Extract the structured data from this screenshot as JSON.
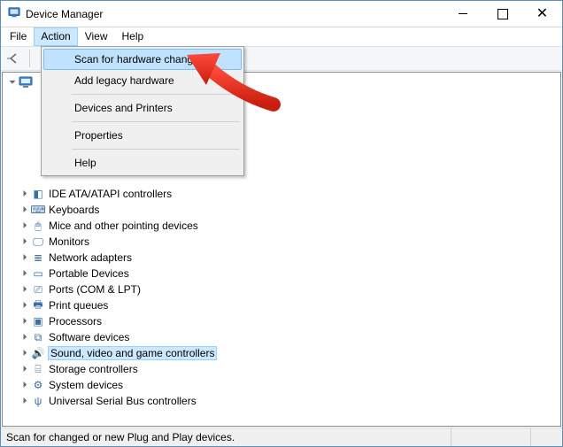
{
  "window": {
    "title": "Device Manager"
  },
  "menubar": {
    "items": [
      {
        "label": "File"
      },
      {
        "label": "Action",
        "open": true
      },
      {
        "label": "View"
      },
      {
        "label": "Help"
      }
    ]
  },
  "action_menu": {
    "items": [
      {
        "label": "Scan for hardware changes",
        "highlight": true
      },
      {
        "label": "Add legacy hardware"
      },
      {
        "sep": true
      },
      {
        "label": "Devices and Printers"
      },
      {
        "sep": true
      },
      {
        "label": "Properties"
      },
      {
        "sep": true
      },
      {
        "label": "Help"
      }
    ]
  },
  "tree": {
    "root_label": "",
    "categories": [
      {
        "label": "IDE ATA/ATAPI controllers",
        "icon": "ide-icon"
      },
      {
        "label": "Keyboards",
        "icon": "keyboard-icon"
      },
      {
        "label": "Mice and other pointing devices",
        "icon": "mouse-icon"
      },
      {
        "label": "Monitors",
        "icon": "monitor-icon"
      },
      {
        "label": "Network adapters",
        "icon": "network-icon"
      },
      {
        "label": "Portable Devices",
        "icon": "portable-icon"
      },
      {
        "label": "Ports (COM & LPT)",
        "icon": "port-icon"
      },
      {
        "label": "Print queues",
        "icon": "printer-icon"
      },
      {
        "label": "Processors",
        "icon": "cpu-icon"
      },
      {
        "label": "Software devices",
        "icon": "software-icon"
      },
      {
        "label": "Sound, video and game controllers",
        "icon": "sound-icon",
        "selected": true
      },
      {
        "label": "Storage controllers",
        "icon": "storage-icon"
      },
      {
        "label": "System devices",
        "icon": "system-icon"
      },
      {
        "label": "Universal Serial Bus controllers",
        "icon": "usb-icon"
      }
    ]
  },
  "statusbar": {
    "text": "Scan for changed or new Plug and Play devices."
  },
  "icons": {
    "computer": "🖥",
    "ide-icon": "◧",
    "keyboard-icon": "⌨",
    "mouse-icon": "🖱",
    "monitor-icon": "🖵",
    "network-icon": "≣",
    "portable-icon": "▭",
    "port-icon": "⎚",
    "printer-icon": "🖶",
    "cpu-icon": "▣",
    "software-icon": "⧉",
    "sound-icon": "🔊",
    "storage-icon": "⌸",
    "system-icon": "⚙",
    "usb-icon": "ψ"
  }
}
